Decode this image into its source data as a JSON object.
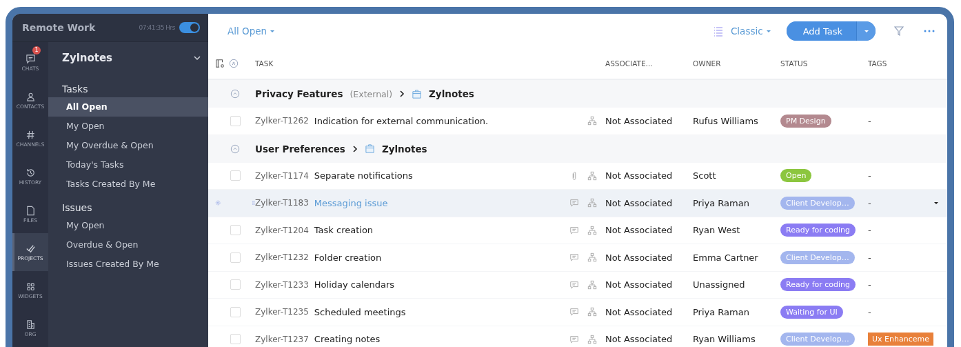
{
  "workspace": {
    "title": "Remote Work",
    "timer": "07:41:35 Hrs",
    "timer_on": true
  },
  "rail": [
    {
      "label": "CHATS",
      "badge": "1",
      "selected": false
    },
    {
      "label": "CONTACTS",
      "selected": false
    },
    {
      "label": "CHANNELS",
      "selected": false
    },
    {
      "label": "HISTORY",
      "selected": false
    },
    {
      "label": "FILES",
      "selected": false
    },
    {
      "label": "PROJECTS",
      "selected": true
    },
    {
      "label": "WIDGETS",
      "selected": false
    },
    {
      "label": "ORG",
      "selected": false
    }
  ],
  "sidebar": {
    "project": "Zylnotes",
    "sections": [
      {
        "title": "Tasks",
        "items": [
          {
            "label": "All Open",
            "selected": true
          },
          {
            "label": "My Open",
            "selected": false
          },
          {
            "label": "My Overdue & Open",
            "selected": false
          },
          {
            "label": "Today's Tasks",
            "selected": false
          },
          {
            "label": "Tasks Created By Me",
            "selected": false
          }
        ]
      },
      {
        "title": "Issues",
        "items": [
          {
            "label": "My Open",
            "selected": false
          },
          {
            "label": "Overdue & Open",
            "selected": false
          },
          {
            "label": "Issues Created By Me",
            "selected": false
          }
        ]
      }
    ]
  },
  "toolbar": {
    "view": "All Open",
    "layout": "Classic",
    "add_button": "Add Task"
  },
  "table": {
    "columns": [
      "TASK",
      "ASSOCIATE...",
      "OWNER",
      "STATUS",
      "TAGS"
    ],
    "rows": [
      {
        "kind": "group",
        "title": "Privacy Features",
        "note": "(External)",
        "project": "Zylnotes"
      },
      {
        "kind": "task",
        "id": "Zylker-T1262",
        "title": "Indication for external communication.",
        "hovered": false,
        "checked": false,
        "attachment": false,
        "comments": false,
        "associated": "Not Associated",
        "owner": "Rufus Williams",
        "status": {
          "label": "PM Design",
          "color": "#b3898f"
        },
        "tag": {
          "label": "-"
        }
      },
      {
        "kind": "group",
        "title": "User Preferences",
        "project": "Zylnotes"
      },
      {
        "kind": "task",
        "id": "Zylker-T1174",
        "title": "Separate notifications",
        "hovered": false,
        "checked": false,
        "attachment": true,
        "comments": false,
        "associated": "Not Associated",
        "owner": "Scott",
        "status": {
          "label": "Open",
          "color": "#8cc63f"
        },
        "tag": {
          "label": "-"
        }
      },
      {
        "kind": "task",
        "id": "Zylker-T1183",
        "title": "Messaging issue",
        "hovered": true,
        "attachment": false,
        "comments": true,
        "associated": "Not Associated",
        "owner": "Priya Raman",
        "status": {
          "label": "Client Develop…",
          "color": "#a3b6ee"
        },
        "tag": {
          "label": "-"
        }
      },
      {
        "kind": "task",
        "id": "Zylker-T1204",
        "title": "Task creation",
        "hovered": false,
        "checked": false,
        "attachment": false,
        "comments": true,
        "associated": "Not Associated",
        "owner": "Ryan West",
        "status": {
          "label": "Ready for coding",
          "color": "#8b7cf3"
        },
        "tag": {
          "label": "-"
        }
      },
      {
        "kind": "task",
        "id": "Zylker-T1232",
        "title": "Folder creation",
        "hovered": false,
        "checked": false,
        "attachment": false,
        "comments": true,
        "associated": "Not Associated",
        "owner": "Emma Cartner",
        "status": {
          "label": "Client Develop…",
          "color": "#a3b6ee"
        },
        "tag": {
          "label": "-"
        }
      },
      {
        "kind": "task",
        "id": "Zylker-T1233",
        "title": "Holiday calendars",
        "hovered": false,
        "checked": false,
        "attachment": false,
        "comments": true,
        "associated": "Not Associated",
        "owner": "Unassigned",
        "status": {
          "label": "Ready for coding",
          "color": "#8b7cf3"
        },
        "tag": {
          "label": "-"
        }
      },
      {
        "kind": "task",
        "id": "Zylker-T1235",
        "title": "Scheduled meetings",
        "hovered": false,
        "checked": false,
        "attachment": false,
        "comments": true,
        "associated": "Not Associated",
        "owner": "Priya Raman",
        "status": {
          "label": "Waiting for UI",
          "color": "#8b7cf3"
        },
        "tag": {
          "label": "-"
        }
      },
      {
        "kind": "task",
        "id": "Zylker-T1237",
        "title": "Creating notes",
        "hovered": false,
        "checked": false,
        "attachment": false,
        "comments": true,
        "associated": "Not Associated",
        "owner": "Ryan Williams",
        "status": {
          "label": "Client Develop…",
          "color": "#a3b6ee"
        },
        "tag": {
          "label": "Ux Enhanceme",
          "color": "#e8803a"
        }
      }
    ]
  }
}
